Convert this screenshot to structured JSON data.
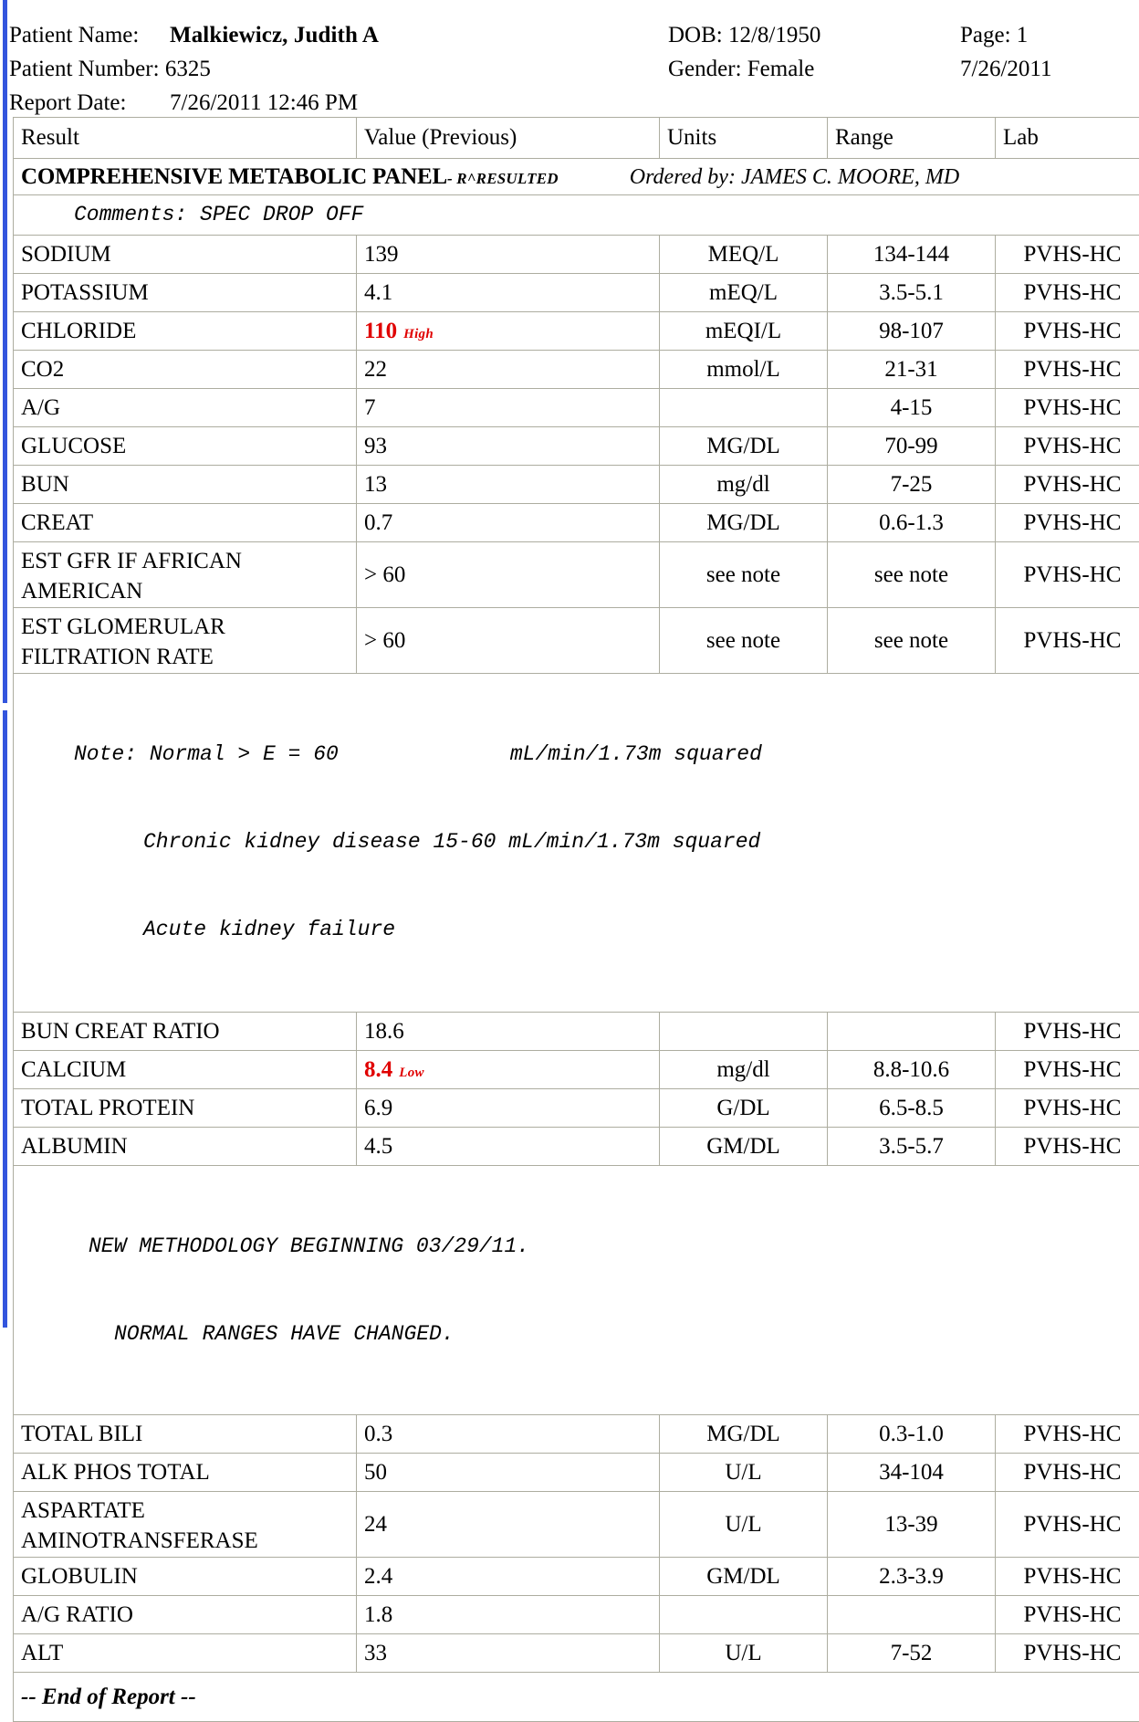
{
  "header": {
    "patient_name_label": "Patient Name:",
    "patient_name": "Malkiewicz, Judith A",
    "patient_number_label": "Patient Number:",
    "patient_number": "6325",
    "report_date_label": "Report Date:",
    "report_date": "7/26/2011 12:46 PM",
    "dob": "DOB: 12/8/1950",
    "gender": "Gender: Female",
    "page": "Page: 1",
    "print_date": "7/26/2011"
  },
  "table": {
    "columns": [
      "Result",
      "Value (Previous)",
      "Units",
      "Range",
      "Lab"
    ],
    "panel": {
      "title": "COMPREHENSIVE METABOLIC PANEL",
      "status": "- R^RESULTED",
      "ordered_by": "Ordered by: JAMES C. MOORE, MD"
    },
    "comments": "Comments: SPEC DROP OFF",
    "rows_group_1": [
      {
        "result": "SODIUM",
        "value": "139",
        "flag": "",
        "units": "MEQ/L",
        "range": "134-144",
        "lab": "PVHS-HC"
      },
      {
        "result": "POTASSIUM",
        "value": "4.1",
        "flag": "",
        "units": "mEQ/L",
        "range": "3.5-5.1",
        "lab": "PVHS-HC"
      },
      {
        "result": "CHLORIDE",
        "value": "110",
        "flag": "High",
        "units": "mEQI/L",
        "range": "98-107",
        "lab": "PVHS-HC"
      },
      {
        "result": "CO2",
        "value": "22",
        "flag": "",
        "units": "mmol/L",
        "range": "21-31",
        "lab": "PVHS-HC"
      },
      {
        "result": "A/G",
        "value": "7",
        "flag": "",
        "units": "",
        "range": "4-15",
        "lab": "PVHS-HC"
      },
      {
        "result": "GLUCOSE",
        "value": "93",
        "flag": "",
        "units": "MG/DL",
        "range": "70-99",
        "lab": "PVHS-HC"
      },
      {
        "result": "BUN",
        "value": "13",
        "flag": "",
        "units": "mg/dl",
        "range": "7-25",
        "lab": "PVHS-HC"
      },
      {
        "result": "CREAT",
        "value": "0.7",
        "flag": "",
        "units": "MG/DL",
        "range": "0.6-1.3",
        "lab": "PVHS-HC"
      }
    ],
    "rows_gfr": [
      {
        "result": "EST GFR IF AFRICAN AMERICAN",
        "value": "> 60",
        "flag": "",
        "units": "see note",
        "range": "see note",
        "lab": "PVHS-HC"
      },
      {
        "result": "EST GLOMERULAR FILTRATION RATE",
        "value": "> 60",
        "flag": "",
        "units": "see note",
        "range": "see note",
        "lab": "PVHS-HC"
      }
    ],
    "gfr_note": {
      "line1_a": "Note: Normal > E = 60",
      "line1_b": "mL/min/1.73m squared",
      "line2": "Chronic kidney disease 15-60 mL/min/1.73m squared",
      "line3": "Acute kidney failure"
    },
    "rows_group_2": [
      {
        "result": "BUN CREAT RATIO",
        "value": "18.6",
        "flag": "",
        "units": "",
        "range": "",
        "lab": "PVHS-HC"
      },
      {
        "result": "CALCIUM",
        "value": "8.4",
        "flag": "Low",
        "units": "mg/dl",
        "range": "8.8-10.6",
        "lab": "PVHS-HC"
      },
      {
        "result": "TOTAL PROTEIN",
        "value": "6.9",
        "flag": "",
        "units": "G/DL",
        "range": "6.5-8.5",
        "lab": "PVHS-HC"
      },
      {
        "result": "ALBUMIN",
        "value": "4.5",
        "flag": "",
        "units": "GM/DL",
        "range": "3.5-5.7",
        "lab": "PVHS-HC"
      }
    ],
    "methodology_note": {
      "line1": "NEW METHODOLOGY BEGINNING 03/29/11.",
      "line2": "NORMAL RANGES HAVE CHANGED."
    },
    "rows_group_3": [
      {
        "result": "TOTAL BILI",
        "value": "0.3",
        "flag": "",
        "units": "MG/DL",
        "range": "0.3-1.0",
        "lab": "PVHS-HC"
      },
      {
        "result": "ALK PHOS TOTAL",
        "value": "50",
        "flag": "",
        "units": "U/L",
        "range": "34-104",
        "lab": "PVHS-HC"
      }
    ],
    "row_ast": {
      "result": "ASPARTATE AMINOTRANSFERASE",
      "value": "24",
      "flag": "",
      "units": "U/L",
      "range": "13-39",
      "lab": "PVHS-HC"
    },
    "rows_group_4": [
      {
        "result": "GLOBULIN",
        "value": "2.4",
        "flag": "",
        "units": "GM/DL",
        "range": "2.3-3.9",
        "lab": "PVHS-HC"
      },
      {
        "result": "A/G RATIO",
        "value": "1.8",
        "flag": "",
        "units": "",
        "range": "",
        "lab": "PVHS-HC"
      },
      {
        "result": "ALT",
        "value": "33",
        "flag": "",
        "units": "U/L",
        "range": "7-52",
        "lab": "PVHS-HC"
      }
    ],
    "footer": "-- End of Report --"
  },
  "colors": {
    "rail": "#3355dd",
    "abnormal": "#e00000",
    "grid": "#adada0"
  }
}
